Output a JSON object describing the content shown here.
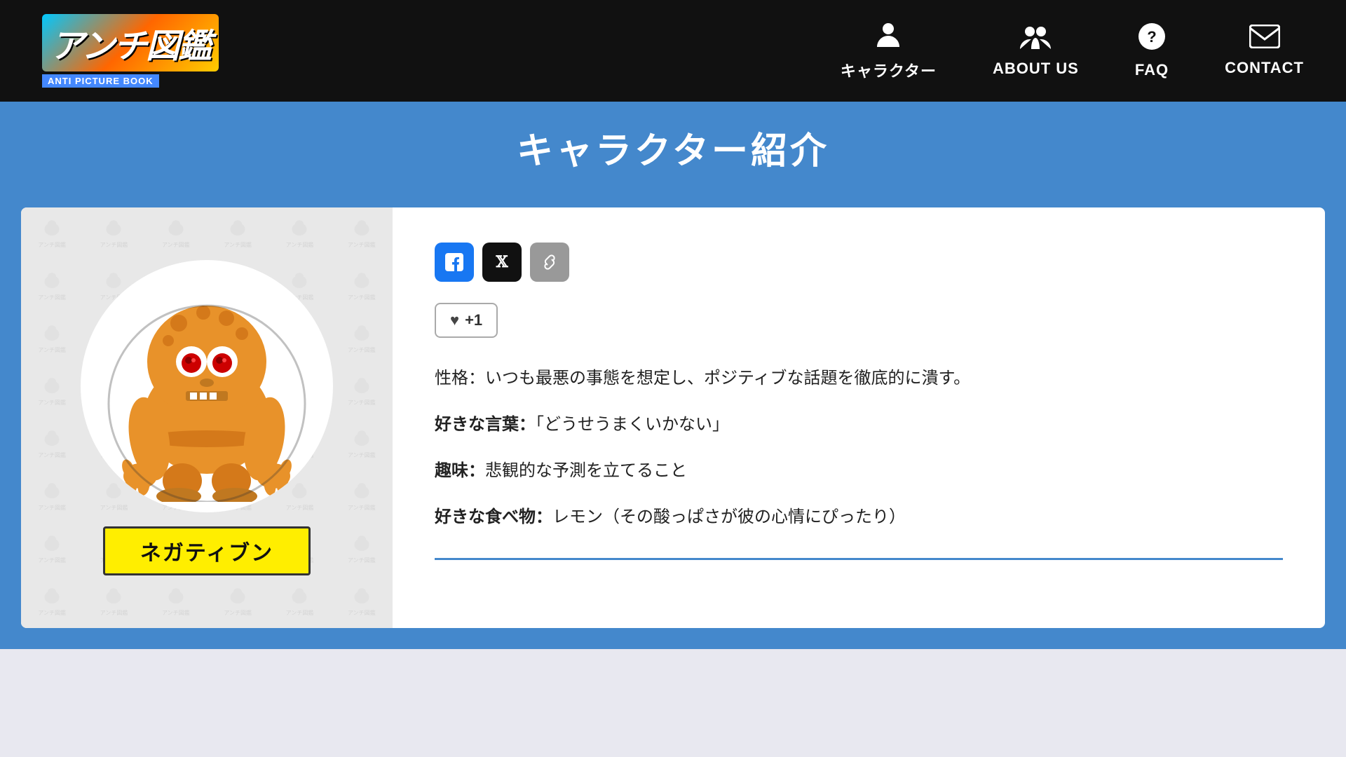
{
  "header": {
    "logo_text": "アンチ図鑑",
    "logo_subtitle": "ANTI PICTURE BOOK",
    "nav": [
      {
        "id": "characters",
        "label": "キャラクター",
        "icon": "👤"
      },
      {
        "id": "about-us",
        "label": "ABOUT US",
        "icon": "👥"
      },
      {
        "id": "faq",
        "label": "FAQ",
        "icon": "❓"
      },
      {
        "id": "contact",
        "label": "CONTACT",
        "icon": "✉"
      }
    ]
  },
  "page": {
    "banner_title": "キャラクター紹介"
  },
  "character": {
    "name": "ネガティブン",
    "personality": "性格：いつも最悪の事態を想定し、ポジティブな話題を徹底的に潰す。",
    "favorite_word_label": "好きな言葉：",
    "favorite_word": "「どうせうまくいかない」",
    "hobby_label": "趣味：",
    "hobby": "悲観的な予測を立てること",
    "favorite_food_label": "好きな食べ物：",
    "favorite_food": "レモン（その酸っぱさが彼の心情にぴったり）",
    "like_count": "+1"
  },
  "social": {
    "facebook_label": "f",
    "twitter_label": "𝕏",
    "link_label": "🔗"
  }
}
